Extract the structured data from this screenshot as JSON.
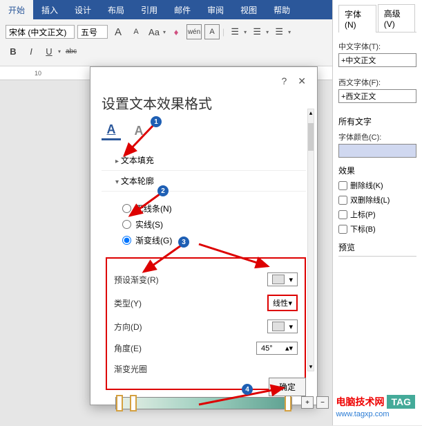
{
  "ribbon": {
    "tabs": [
      "开始",
      "插入",
      "设计",
      "布局",
      "引用",
      "邮件",
      "审阅",
      "视图",
      "帮助"
    ],
    "active_tab": 0,
    "font_name": "宋体 (中文正文)",
    "font_size": "五号",
    "buttons": {
      "grow": "A",
      "shrink": "A",
      "phonetic": "Aa",
      "clear": "A",
      "circled": "wén",
      "char_border": "A",
      "bold": "B",
      "italic": "I",
      "underline": "U",
      "strike": "abc"
    }
  },
  "ruler": {
    "mark": "10"
  },
  "dialog": {
    "title": "设置文本效果格式",
    "help": "?",
    "close": "✕",
    "section_fill": "文本填充",
    "section_outline": "文本轮廓",
    "radio": {
      "none": "无线条(N)",
      "solid": "实线(S)",
      "gradient": "渐变线(G)"
    },
    "opts": {
      "preset": "预设渐变(R)",
      "type": "类型(Y)",
      "type_val": "线性",
      "direction": "方向(D)",
      "angle": "角度(E)",
      "angle_val": "45°",
      "stops": "渐变光圈"
    },
    "ok": "确定"
  },
  "right_panel": {
    "tab_font": "字体(N)",
    "tab_adv": "高级(V)",
    "cn_font_label": "中文字体(T):",
    "cn_font_val": "+中文正文",
    "en_font_label": "西文字体(F):",
    "en_font_val": "+西文正文",
    "all_text": "所有文字",
    "font_color": "字体颜色(C):",
    "effects": "效果",
    "strike": "删除线(K)",
    "dbl_strike": "双删除线(L)",
    "superscript": "上标(P)",
    "subscript": "下标(B)",
    "preview": "预览"
  },
  "watermark": {
    "text1": "电脑技术网",
    "tag": "TAG",
    "url": "www.tagxp.com"
  },
  "badges": [
    "1",
    "2",
    "3",
    "4"
  ]
}
